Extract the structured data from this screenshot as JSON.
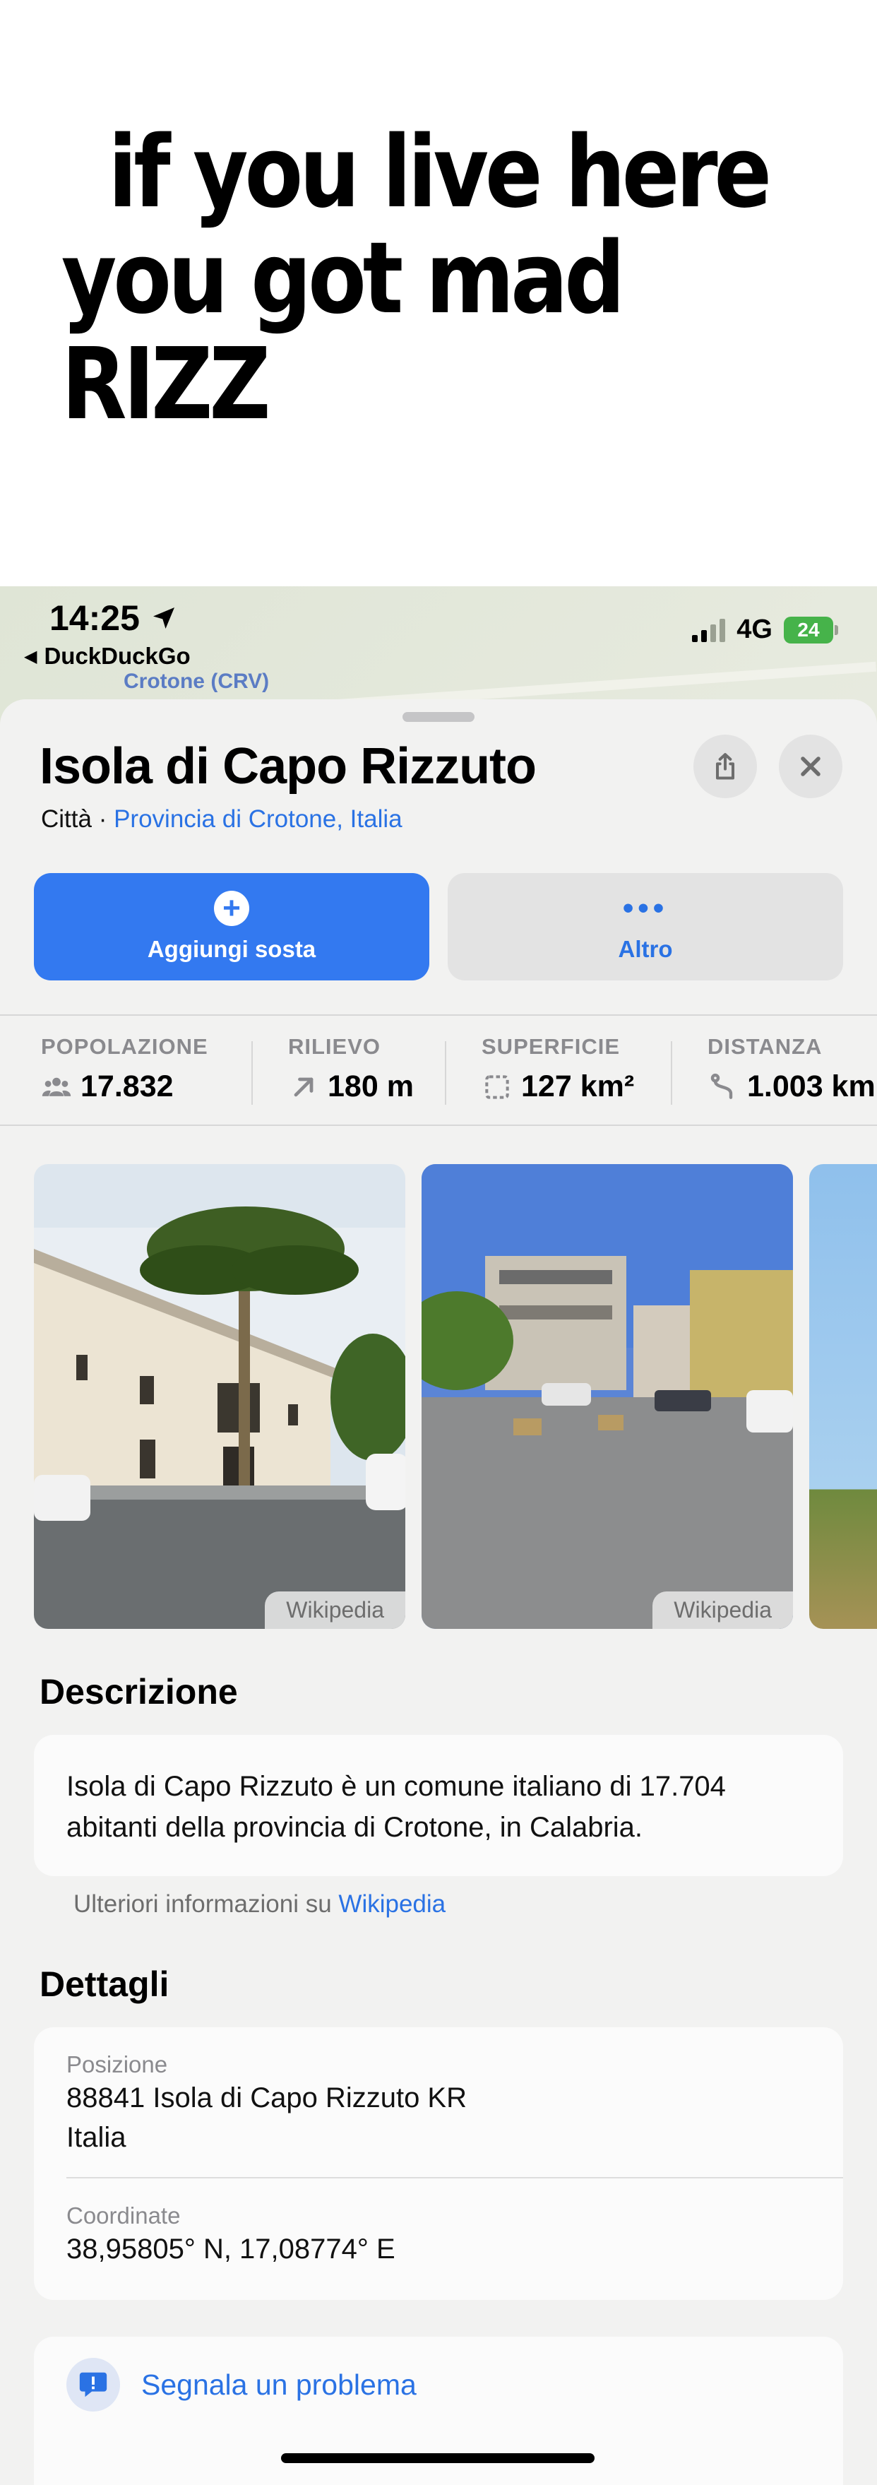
{
  "meme": {
    "line1": "if you live here",
    "line2": "you got mad RIZZ"
  },
  "status_bar": {
    "time": "14:25",
    "back_app": "DuckDuckGo",
    "network": "4G",
    "battery": "24"
  },
  "map": {
    "label": "Crotone (CRV)"
  },
  "place": {
    "title": "Isola di Capo Rizzuto",
    "type": "Città · ",
    "region": "Provincia di Crotone, Italia"
  },
  "actions": {
    "add_stop": "Aggiungi sosta",
    "more": "Altro"
  },
  "stats": [
    {
      "label": "POPOLAZIONE",
      "value": "17.832",
      "icon": "people-icon"
    },
    {
      "label": "RILIEVO",
      "value": "180 m",
      "icon": "elevation-arrow-icon"
    },
    {
      "label": "SUPERFICIE",
      "value": "127 km²",
      "icon": "area-icon"
    },
    {
      "label": "DISTANZA",
      "value": "1.003 km",
      "icon": "route-icon"
    }
  ],
  "photos": {
    "source1": "Wikipedia",
    "source2": "Wikipedia"
  },
  "description": {
    "title": "Descrizione",
    "text": "Isola di Capo Rizzuto è un comune italiano di 17.704 abitanti della provincia di Crotone, in Calabria.",
    "more_prefix": "Ulteriori informazioni su ",
    "more_link": "Wikipedia"
  },
  "details": {
    "title": "Dettagli",
    "position_label": "Posizione",
    "position_line1": "88841 Isola di Capo Rizzuto KR",
    "position_line2": "Italia",
    "coords_label": "Coordinate",
    "coords_value": "38,95805° N, 17,08774° E"
  },
  "links": {
    "report": "Segnala un problema"
  },
  "colors": {
    "accent": "#3379f0",
    "link": "#2a72e4",
    "sheet_bg": "#f2f2f1"
  }
}
